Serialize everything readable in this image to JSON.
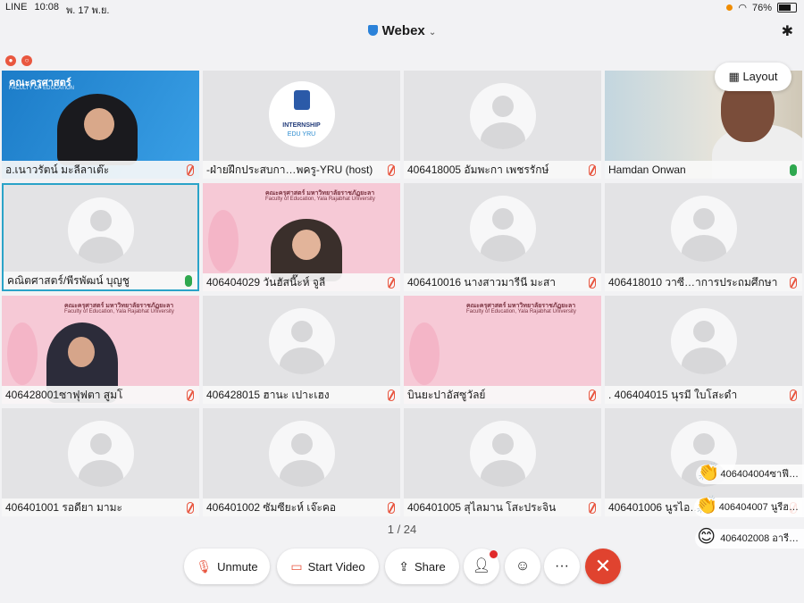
{
  "status": {
    "carrier": "LINE",
    "time": "10:08",
    "date": "พ. 17 พ.ย.",
    "battery": "76%",
    "battery_level": 0.76
  },
  "app": {
    "title": "Webex"
  },
  "layout_button": "Layout",
  "page_indicator": "1 / 24",
  "tiles": [
    {
      "name": "อ.เนาวรัตน์ มะลีลาเต๊ะ",
      "mic": "muted",
      "kind": "video-blue",
      "banner": "คณะครุศาสตร์",
      "banner_sub": "FACULTY OF EDUCATION"
    },
    {
      "name": "-ฝ่ายฝึกประสบกา…พครู-YRU (host)",
      "mic": "muted",
      "kind": "logo",
      "logo_text1": "INTERNSHIP",
      "logo_text2": "EDU YRU"
    },
    {
      "name": "406418005 อัมพะกา เพชรรักษ์",
      "mic": "muted",
      "kind": "avatar"
    },
    {
      "name": "Hamdan Onwan",
      "mic": "on",
      "kind": "video-room"
    },
    {
      "name": "คณิตศาสตร์/พีรพัฒน์ บุญชู",
      "mic": "on",
      "kind": "avatar",
      "selected": true
    },
    {
      "name": "406404029 วันฮัสนี๊ะห์ จูลี",
      "mic": "muted",
      "kind": "video-pink",
      "banner": "คณะครุศาสตร์ มหาวิทยาลัยราชภัฏยะลา",
      "banner_sub": "Faculty of Education, Yala Rajabhat University"
    },
    {
      "name": "406410016 นางสาวมารีนี มะสา",
      "mic": "muted",
      "kind": "avatar"
    },
    {
      "name": "406418010 วาซี…าการประถมศึกษา",
      "mic": "muted",
      "kind": "avatar"
    },
    {
      "name": "406428001ซาฟุฟตา สูมโ",
      "mic": "muted",
      "kind": "video-pink-person",
      "banner": "คณะครุศาสตร์ มหาวิทยาลัยราชภัฏยะลา",
      "banner_sub": "Faculty of Education, Yala Rajabhat University"
    },
    {
      "name": "406428015 ฮานะ เปาะเฮง",
      "mic": "muted",
      "kind": "avatar"
    },
    {
      "name": "บินยะปาอัสซูวัลย์",
      "mic": "muted",
      "kind": "video-pink-empty",
      "banner": "คณะครุศาสตร์ มหาวิทยาลัยราชภัฏยะลา",
      "banner_sub": "Faculty of Education, Yala Rajabhat University"
    },
    {
      "name": ". 406404015 นุรมี ใบโสะดำ",
      "mic": "muted",
      "kind": "avatar"
    },
    {
      "name": "406401001 รอดียา มามะ",
      "mic": "muted",
      "kind": "avatar"
    },
    {
      "name": "406401002 ซัมซียะห์ เจ๊ะคอ",
      "mic": "muted",
      "kind": "avatar"
    },
    {
      "name": "406401005 สุไลมาน โสะประจิน",
      "mic": "muted",
      "kind": "avatar"
    },
    {
      "name": "406401006 นูรไอ…",
      "mic": "muted",
      "kind": "avatar"
    }
  ],
  "reactions": [
    {
      "emoji": "👏",
      "text": "406404004ซาฟี…"
    },
    {
      "emoji": "👏",
      "text": "406404007 นูรีฮ…"
    },
    {
      "emoji": "😊",
      "text": "406402008 อารี…"
    }
  ],
  "toolbar": {
    "unmute": "Unmute",
    "start_video": "Start Video",
    "share": "Share",
    "more": "···",
    "end": "✕"
  },
  "colors": {
    "accent": "#2aa3c8",
    "end_call": "#e0432f",
    "mic_muted": "#e8553f",
    "mic_on": "#2fa84f"
  }
}
